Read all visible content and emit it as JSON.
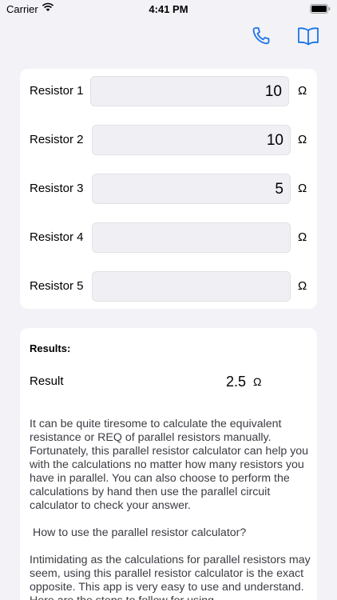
{
  "status_bar": {
    "carrier": "Carrier",
    "time": "4:41 PM"
  },
  "nav": {
    "icons": [
      "phone-icon",
      "book-icon"
    ],
    "accent": "#1a73e8"
  },
  "inputs": [
    {
      "label": "Resistor 1",
      "value": "10",
      "unit": "Ω"
    },
    {
      "label": "Resistor 2",
      "value": "10",
      "unit": "Ω"
    },
    {
      "label": "Resistor 3",
      "value": "5",
      "unit": "Ω"
    },
    {
      "label": "Resistor 4",
      "value": "",
      "unit": "Ω"
    },
    {
      "label": "Resistor 5",
      "value": "",
      "unit": "Ω"
    }
  ],
  "results": {
    "title": "Results:",
    "result_label": "Result",
    "result_value": "2.5",
    "result_unit": "Ω"
  },
  "description": {
    "para1": "It can be quite tiresome to calculate the equivalent resistance or REQ of parallel resistors manually. Fortunately, this parallel resistor calculator can help you with the calculations no matter how many resistors you have in parallel. You can also choose to perform the calculations by hand then use the parallel circuit calculator to check your answer.",
    "para2": " How to use the parallel resistor calculator?",
    "para3": " Intimidating as the calculations for parallel resistors may seem, using this parallel resistor calculator is the exact opposite. This app is very easy to use and understand. Here are the steps to follow for using"
  }
}
